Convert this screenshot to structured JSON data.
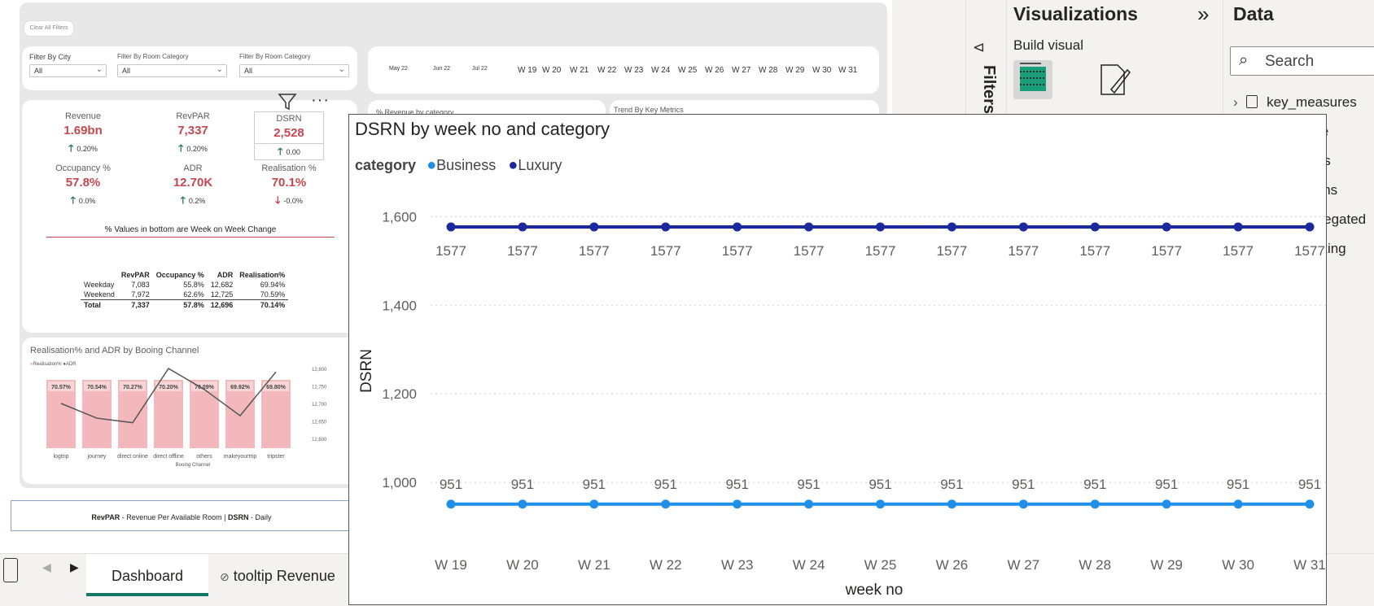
{
  "dashboard": {
    "clear_filters": "Clear All Filters",
    "filters": [
      {
        "label": "Filter By City",
        "value": "All"
      },
      {
        "label": "Filter By Room Category",
        "value": "All"
      },
      {
        "label": "Filter By Room Category",
        "value": "All"
      }
    ],
    "date_slicer": [
      "May 22",
      "Jun 22",
      "Jul 22",
      "W 19",
      "W 20",
      "W 21",
      "W 22",
      "W 23",
      "W 24",
      "W 25",
      "W 26",
      "W 27",
      "W 28",
      "W 29",
      "W 30",
      "W 31"
    ],
    "kpis": [
      {
        "title": "Revenue",
        "value": "1.69bn",
        "change": "0.20%",
        "dir": "up"
      },
      {
        "title": "RevPAR",
        "value": "7,337",
        "change": "0.20%",
        "dir": "up"
      },
      {
        "title": "DSRN",
        "value": "2,528",
        "change": "0.00",
        "dir": "up"
      },
      {
        "title": "Occupancy %",
        "value": "57.8%",
        "change": "0.0%",
        "dir": "up"
      },
      {
        "title": "ADR",
        "value": "12.70K",
        "change": "0.2%",
        "dir": "up"
      },
      {
        "title": "Realisation %",
        "value": "70.1%",
        "change": "-0.0%",
        "dir": "down"
      }
    ],
    "kpi_note": "% Values in bottom are Week on Week Change",
    "mini_table": {
      "headers": [
        "",
        "RevPAR",
        "Occupancy %",
        "ADR",
        "Realisation%"
      ],
      "rows": [
        [
          "Weekday",
          "7,083",
          "55.8%",
          "12,682",
          "69.94%"
        ],
        [
          "Weekend",
          "7,972",
          "62.6%",
          "12,725",
          "70.59%"
        ],
        [
          "Total",
          "7,337",
          "57.8%",
          "12,696",
          "70.14%"
        ]
      ]
    },
    "revenue_by_category_title": "% Revenue by category",
    "trend_title": "Trend By Key Metrics",
    "channel_chart": {
      "title": "Realisation% and ADR by Booing Channel",
      "legend": [
        "Realisation%",
        "ADR"
      ],
      "categories": [
        "logtrip",
        "journey",
        "direct online",
        "direct offline",
        "others",
        "makeyourtrip",
        "tripster"
      ],
      "bar_labels": [
        "70.57%",
        "70.54%",
        "70.27%",
        "70.20%",
        "70.09%",
        "69.92%",
        "69.80%"
      ],
      "xlabel": "Booing Channel",
      "y2_ticks": [
        "12,800",
        "12,750",
        "12,700",
        "12,650",
        "12,600"
      ],
      "adr_values": [
        12700,
        12658,
        12645,
        12800,
        12740,
        12665,
        12790
      ]
    },
    "footer_text_bold1": "RevPAR",
    "footer_text1": " - Revenue Per Available Room | ",
    "footer_text_bold2": "DSRN",
    "footer_text2": " - Daily"
  },
  "panes": {
    "filters_label": "Filters",
    "visualizations_title": "Visualizations",
    "build_visual": "Build visual",
    "data_title": "Data",
    "search_placeholder": "Search",
    "data_items": [
      "key_measures",
      "te",
      "els",
      "oms",
      "gregated",
      "oking"
    ]
  },
  "tabs": {
    "active": "Dashboard",
    "other": "tooltip Revenue"
  },
  "popup": {
    "title": "DSRN by week no and category"
  },
  "colors": {
    "business": "#1f8fe8",
    "luxury": "#1a2a9c",
    "kpi_red": "#c6474f",
    "accent_tab": "#117865"
  },
  "chart_data": {
    "type": "line",
    "title": "DSRN by week no and category",
    "legend_title": "category",
    "xlabel": "week no",
    "ylabel": "DSRN",
    "categories": [
      "W 19",
      "W 20",
      "W 21",
      "W 22",
      "W 23",
      "W 24",
      "W 25",
      "W 26",
      "W 27",
      "W 28",
      "W 29",
      "W 30",
      "W 31"
    ],
    "series": [
      {
        "name": "Business",
        "values": [
          951,
          951,
          951,
          951,
          951,
          951,
          951,
          951,
          951,
          951,
          951,
          951,
          951
        ]
      },
      {
        "name": "Luxury",
        "values": [
          1577,
          1577,
          1577,
          1577,
          1577,
          1577,
          1577,
          1577,
          1577,
          1577,
          1577,
          1577,
          1577
        ]
      }
    ],
    "yticks": [
      1000,
      1200,
      1400,
      1600
    ],
    "ytick_labels": [
      "1,000",
      "1,200",
      "1,400",
      "1,600"
    ],
    "ylim": [
      912,
      1632
    ],
    "grid": true,
    "legend_position": "top-left"
  }
}
